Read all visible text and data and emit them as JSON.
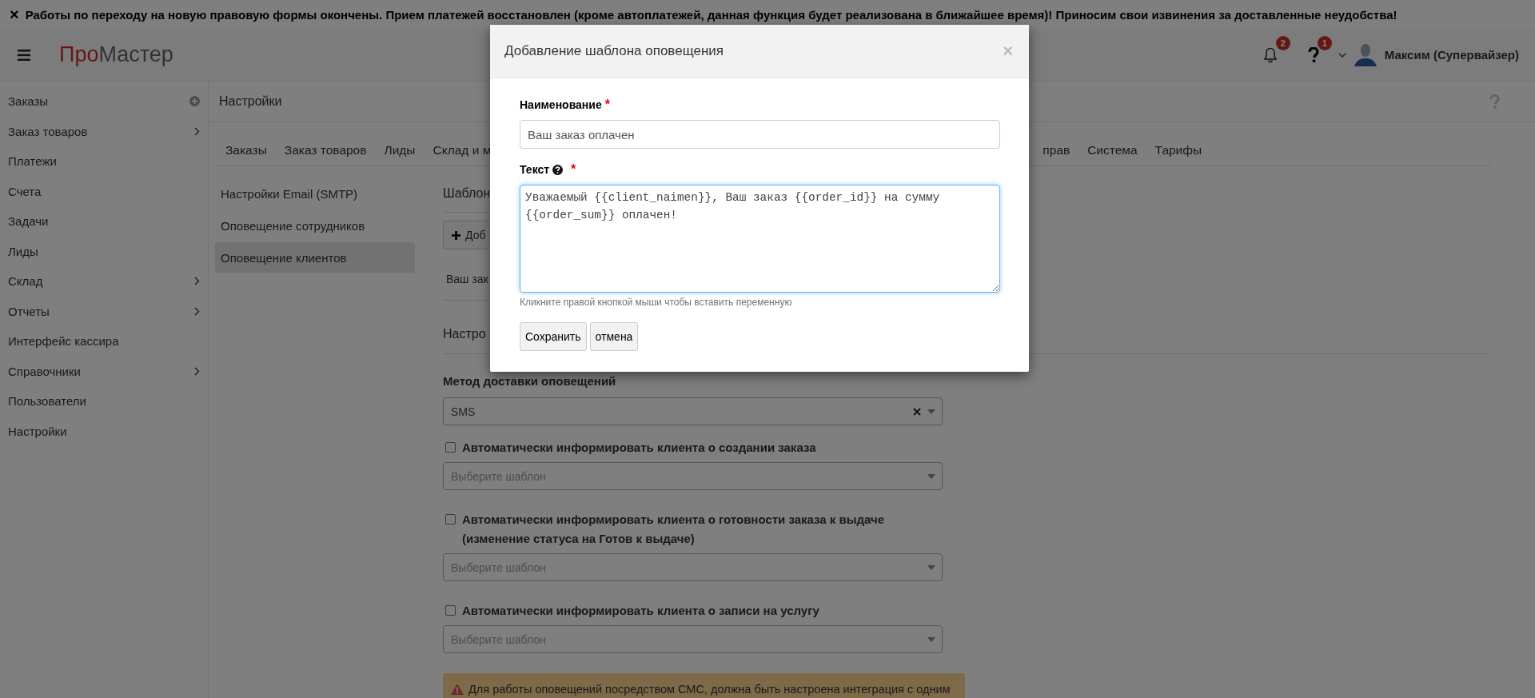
{
  "announcement": {
    "close": "×",
    "text": "Работы по переходу на новую правовую формы окончены. Прием платежей восстановлен (кроме автоплатежей, данная функция будет реализована в ближайшее время)! Приносим свои извинения за доставленные неудобства!"
  },
  "header": {
    "logo_accent": "Про",
    "logo_rest": "Мастер",
    "notifications_badge": "2",
    "help_badge": "1",
    "user_name": "Максим (Супервайзер)"
  },
  "sidebar": {
    "items": [
      {
        "label": "Заказы",
        "kind": "add"
      },
      {
        "label": "Заказ товаров",
        "kind": "submenu"
      },
      {
        "label": "Платежи",
        "kind": "plain"
      },
      {
        "label": "Счета",
        "kind": "plain"
      },
      {
        "label": "Задачи",
        "kind": "plain"
      },
      {
        "label": "Лиды",
        "kind": "plain"
      },
      {
        "label": "Склад",
        "kind": "submenu"
      },
      {
        "label": "Отчеты",
        "kind": "submenu"
      },
      {
        "label": "Интерфейс кассира",
        "kind": "plain"
      },
      {
        "label": "Справочники",
        "kind": "submenu"
      },
      {
        "label": "Пользователи",
        "kind": "plain"
      },
      {
        "label": "Настройки",
        "kind": "plain"
      }
    ]
  },
  "page": {
    "title": "Настройки",
    "tabs_left": [
      "Заказы",
      "Заказ товаров",
      "Лиды",
      "Склад и м"
    ],
    "tabs_right": [
      "прав",
      "Система",
      "Тарифы"
    ],
    "settings_menu": [
      {
        "label": "Настройки Email (SMTP)",
        "selected": false
      },
      {
        "label": "Оповещение сотрудников",
        "selected": false
      },
      {
        "label": "Оповещение клиентов",
        "selected": true
      }
    ],
    "section_title": "Шаблон",
    "add_button": "Доб",
    "template_row": "Ваш зак",
    "settings_title": "Настро",
    "delivery": {
      "label": "Метод доставки оповещений",
      "value": "SMS"
    },
    "auto_options": [
      {
        "label": "Автоматически информировать клиента о создании заказа",
        "checked": false,
        "placeholder": "Выберите шаблон"
      },
      {
        "label": "Автоматически информировать клиента о готовности заказа к выдаче (изменение статуса на Готов к выдаче)",
        "checked": false,
        "placeholder": "Выберите шаблон"
      },
      {
        "label": "Автоматически информировать клиента о записи на услугу",
        "checked": false,
        "placeholder": "Выберите шаблон"
      }
    ],
    "warning": "Для работы оповещений посредством СМС, должна быть настроена интеграция с одним"
  },
  "modal": {
    "title": "Добавление шаблона оповещения",
    "close": "×",
    "name_label": "Наименование",
    "name_required": "*",
    "name_value": "Ваш заказ оплачен",
    "text_label": "Текст",
    "text_required": "*",
    "text_value": "Уважаемый {{client_naimen}}, Ваш заказ {{order_id}} на сумму {{order_sum}} оплачен!",
    "hint": "Кликните правой кнопкой мыши чтобы вставить переменную",
    "buttons": [
      "Сохранить",
      "отмена"
    ]
  }
}
